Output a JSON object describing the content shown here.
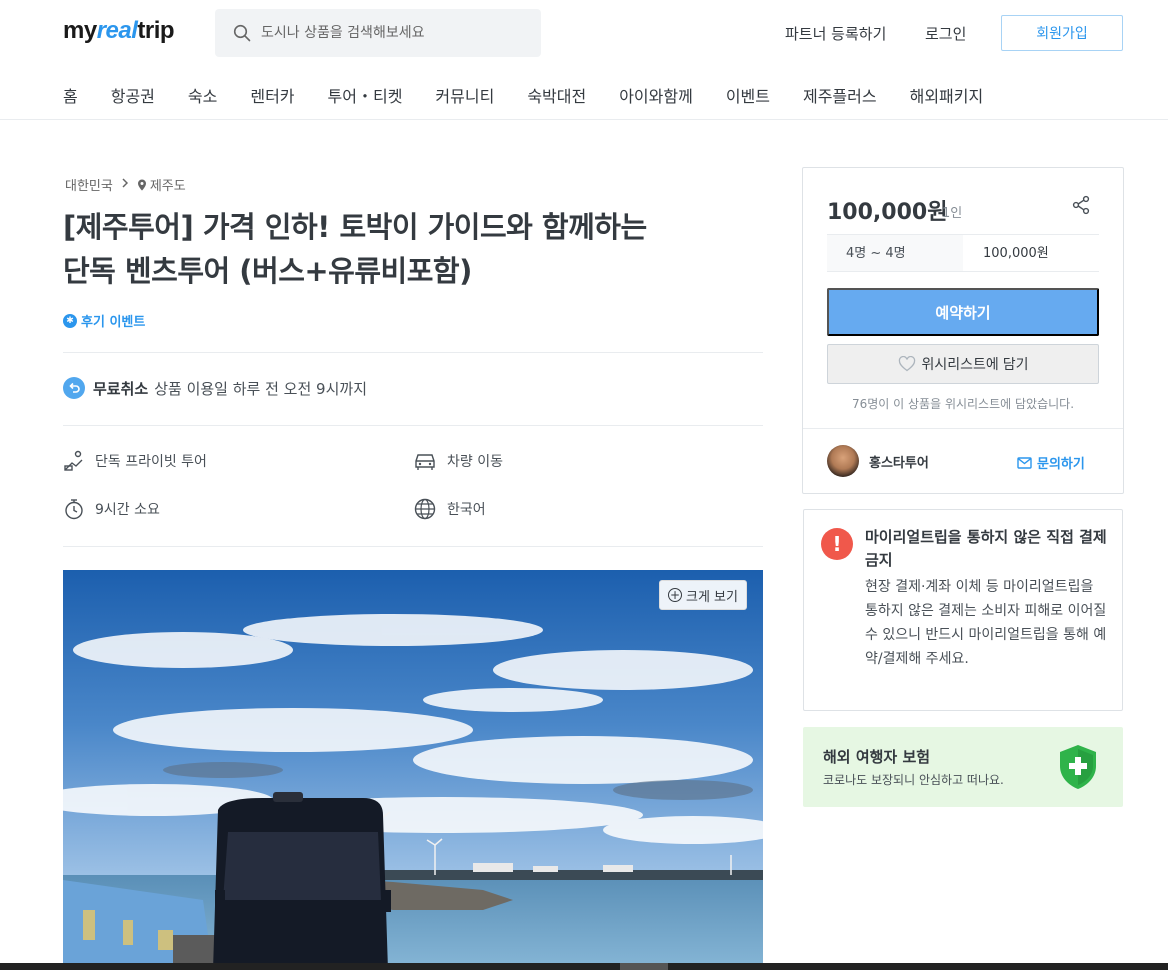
{
  "header": {
    "logo_main": "my",
    "logo_accent": "real",
    "logo_end": "trip",
    "search_placeholder": "도시나 상품을 검색해보세요",
    "partner_link": "파트너 등록하기",
    "login_link": "로그인",
    "signup_button": "회원가입"
  },
  "nav": [
    "홈",
    "항공권",
    "숙소",
    "렌터카",
    "투어・티켓",
    "커뮤니티",
    "숙박대전",
    "아이와함께",
    "이벤트",
    "제주플러스",
    "해외패키지"
  ],
  "breadcrumb": {
    "country": "대한민국",
    "region": "제주도"
  },
  "product": {
    "title_line1": "[제주투어] 가격 인하! 토박이 가이드와 함께하는",
    "title_line2": "단독 벤츠투어 (버스+유류비포함)",
    "review_event": "후기 이벤트",
    "cancel_bold": "무료취소",
    "cancel_text": "상품 이용일 하루 전 오전 9시까지",
    "features": {
      "tour_type": "단독 프라이빗 투어",
      "transport": "차량 이동",
      "duration": "9시간 소요",
      "language": "한국어"
    },
    "zoom_button": "크게 보기"
  },
  "booking": {
    "price": "100,000원",
    "per": "1인",
    "option_people": "4명 ~ 4명",
    "option_price": "100,000원",
    "book_button": "예약하기",
    "wishlist_button": "위시리스트에 담기",
    "wishlist_count_text": "76명이 이 상품을 위시리스트에 담았습니다.",
    "host_name": "홍스타투어",
    "inquiry_button": "문의하기"
  },
  "warning": {
    "icon": "!",
    "title": "마이리얼트립을 통하지 않은 직접 결제 금지",
    "body": "현장 결제·계좌 이체 등 마이리얼트립을 통하지 않은 결제는 소비자 피해로 이어질 수 있으니 반드시 마이리얼트립을 통해 예약/결제해 주세요."
  },
  "insurance": {
    "title": "해외 여행자 보험",
    "subtitle": "코로나도 보장되니 안심하고 떠나요."
  },
  "colors": {
    "accent": "#2b96ed",
    "book_button": "#66aaf0",
    "warning": "#f0584b",
    "insurance_bg": "#e6f7e3",
    "shield": "#2fb34a"
  }
}
